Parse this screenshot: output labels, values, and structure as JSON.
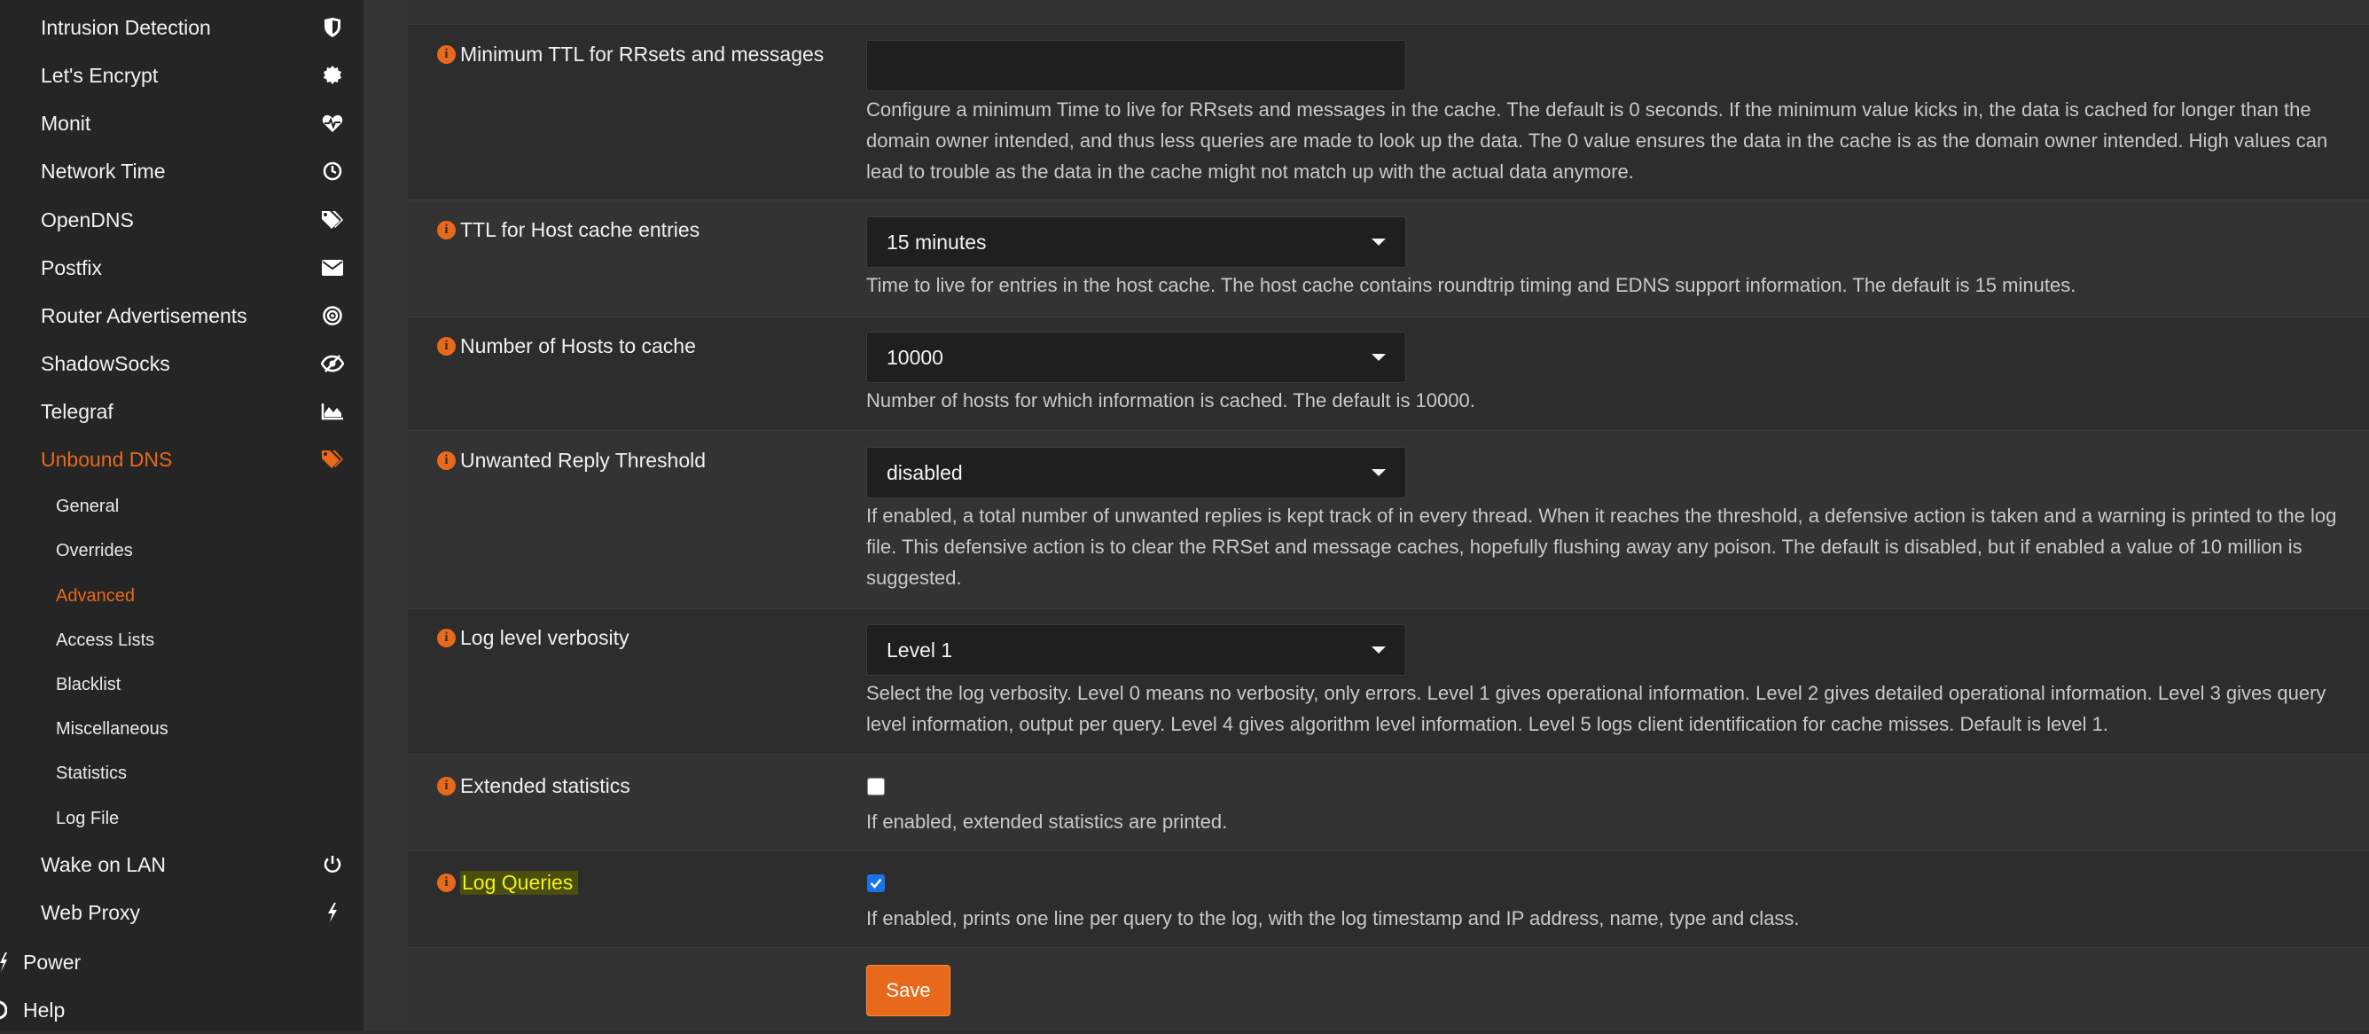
{
  "sidebar": {
    "services": [
      {
        "label": "Intrusion Detection",
        "icon": "shield-icon"
      },
      {
        "label": "Let's Encrypt",
        "icon": "certificate-icon"
      },
      {
        "label": "Monit",
        "icon": "heartbeat-icon"
      },
      {
        "label": "Network Time",
        "icon": "clock-icon"
      },
      {
        "label": "OpenDNS",
        "icon": "tags-icon"
      },
      {
        "label": "Postfix",
        "icon": "envelope-icon"
      },
      {
        "label": "Router Advertisements",
        "icon": "bullseye-icon"
      },
      {
        "label": "ShadowSocks",
        "icon": "eye-slash-icon"
      },
      {
        "label": "Telegraf",
        "icon": "area-chart-icon"
      },
      {
        "label": "Unbound DNS",
        "icon": "tags-icon",
        "active": true
      }
    ],
    "unbound_sub": [
      {
        "label": "General"
      },
      {
        "label": "Overrides"
      },
      {
        "label": "Advanced",
        "active": true
      },
      {
        "label": "Access Lists"
      },
      {
        "label": "Blacklist"
      },
      {
        "label": "Miscellaneous"
      },
      {
        "label": "Statistics"
      },
      {
        "label": "Log File"
      }
    ],
    "more_services": [
      {
        "label": "Wake on LAN",
        "icon": "power-icon"
      },
      {
        "label": "Web Proxy",
        "icon": "bolt-icon"
      }
    ],
    "top_level": [
      {
        "label": "Power",
        "icon": "plug-icon"
      },
      {
        "label": "Help",
        "icon": "help-icon"
      }
    ]
  },
  "settings": {
    "min_ttl": {
      "label": "Minimum TTL for RRsets and messages",
      "value": "",
      "help": "Configure a minimum Time to live for RRsets and messages in the cache. The default is 0 seconds. If the minimum value kicks in, the data is cached for longer than the domain owner intended, and thus less queries are made to look up the data. The 0 value ensures the data in the cache is as the domain owner intended. High values can lead to trouble as the data in the cache might not match up with the actual data anymore."
    },
    "host_ttl": {
      "label": "TTL for Host cache entries",
      "value": "15 minutes",
      "help": "Time to live for entries in the host cache. The host cache contains roundtrip timing and EDNS support information. The default is 15 minutes."
    },
    "num_hosts": {
      "label": "Number of Hosts to cache",
      "value": "10000",
      "help": "Number of hosts for which information is cached. The default is 10000."
    },
    "unwanted_reply": {
      "label": "Unwanted Reply Threshold",
      "value": "disabled",
      "help": "If enabled, a total number of unwanted replies is kept track of in every thread. When it reaches the threshold, a defensive action is taken and a warning is printed to the log file. This defensive action is to clear the RRSet and message caches, hopefully flushing away any poison. The default is disabled, but if enabled a value of 10 million is suggested."
    },
    "log_verbosity": {
      "label": "Log level verbosity",
      "value": "Level 1",
      "help": "Select the log verbosity. Level 0 means no verbosity, only errors. Level 1 gives operational information. Level 2 gives detailed operational information. Level 3 gives query level information, output per query. Level 4 gives algorithm level information. Level 5 logs client identification for cache misses. Default is level 1."
    },
    "extended_stats": {
      "label": "Extended statistics",
      "checked": false,
      "help": "If enabled, extended statistics are printed."
    },
    "log_queries": {
      "label": "Log Queries",
      "checked": true,
      "help": "If enabled, prints one line per query to the log, with the log timestamp and IP address, name, type and class."
    }
  },
  "actions": {
    "save_label": "Save"
  },
  "colors": {
    "accent": "#e8691b",
    "highlight": "#f3f21b",
    "sidebar_bg": "#252525",
    "main_bg": "#2d2d2d"
  }
}
